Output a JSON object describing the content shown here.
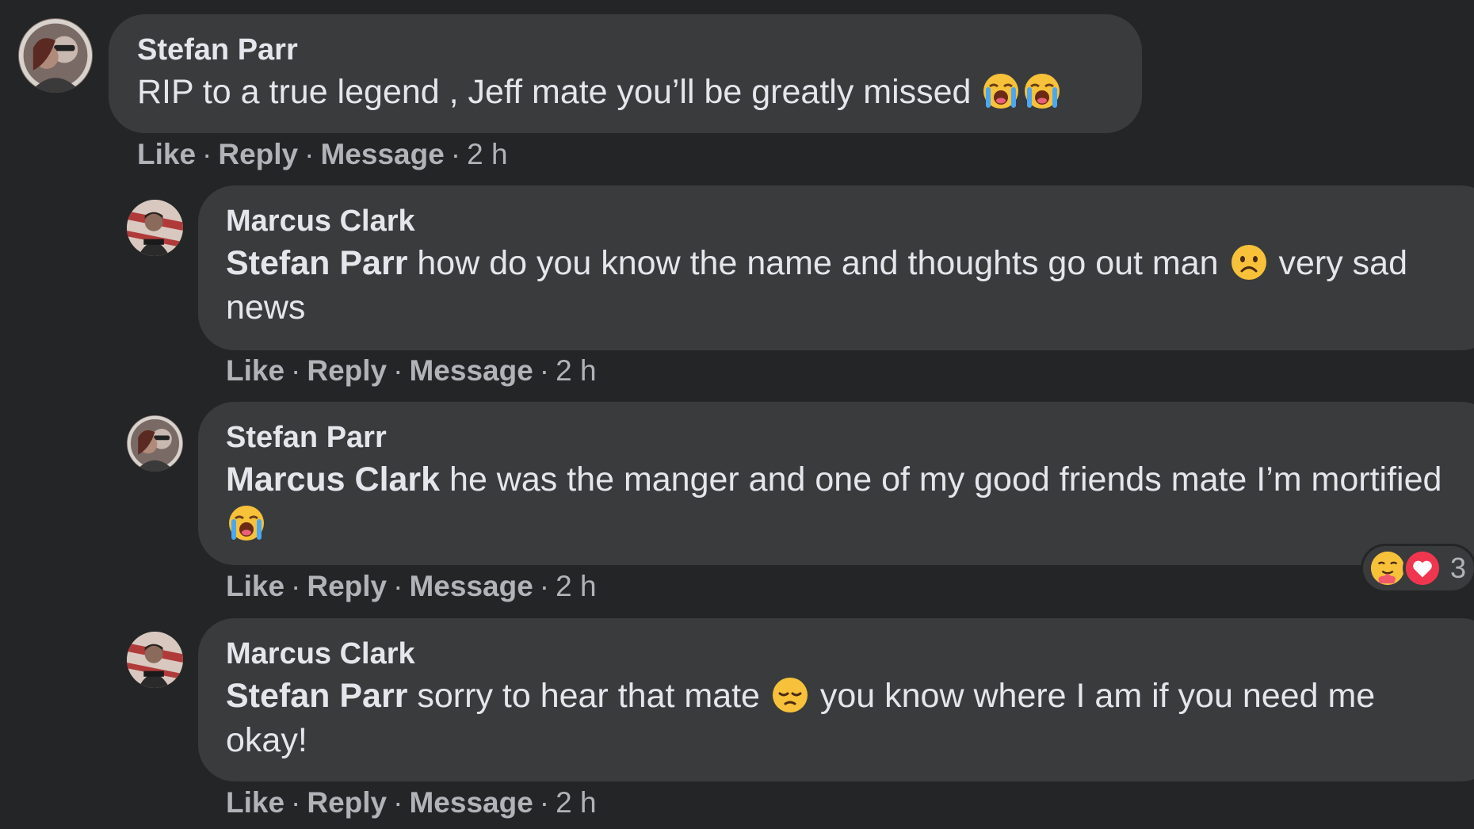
{
  "comments": [
    {
      "author": "Stefan Parr",
      "text": "RIP to a true legend , Jeff mate you’ll be greatly missed",
      "emojis": [
        "crying-face",
        "crying-face"
      ],
      "actions": {
        "like": "Like",
        "reply": "Reply",
        "message": "Message",
        "time": "2 h"
      }
    },
    {
      "author": "Marcus Clark",
      "mention": "Stefan Parr",
      "text_before_emoji": " how do you know the name and thoughts go out man ",
      "emoji": "frowning-face",
      "text_after_emoji": " very sad news",
      "actions": {
        "like": "Like",
        "reply": "Reply",
        "message": "Message",
        "time": "2 h"
      }
    },
    {
      "author": "Stefan Parr",
      "mention": "Marcus Clark",
      "text": " he was the manger and one of my good friends mate I’m mortified",
      "emoji": "crying-face",
      "actions": {
        "like": "Like",
        "reply": "Reply",
        "message": "Message",
        "time": "2 h"
      },
      "reactions": {
        "icons": [
          "care-reaction",
          "love-reaction"
        ],
        "count": "3"
      }
    },
    {
      "author": "Marcus Clark",
      "mention": "Stefan Parr",
      "text_before_emoji": " sorry to hear that mate ",
      "emoji": "pensive-face",
      "text_after_emoji": " you know where I am if you need me okay!",
      "actions": {
        "like": "Like",
        "reply": "Reply",
        "message": "Message",
        "time": "2 h"
      }
    }
  ],
  "dot": "·",
  "colors": {
    "background": "#242526",
    "bubble": "#3a3b3c",
    "text": "#e4e6eb",
    "secondary_text": "#b0b3b8"
  }
}
